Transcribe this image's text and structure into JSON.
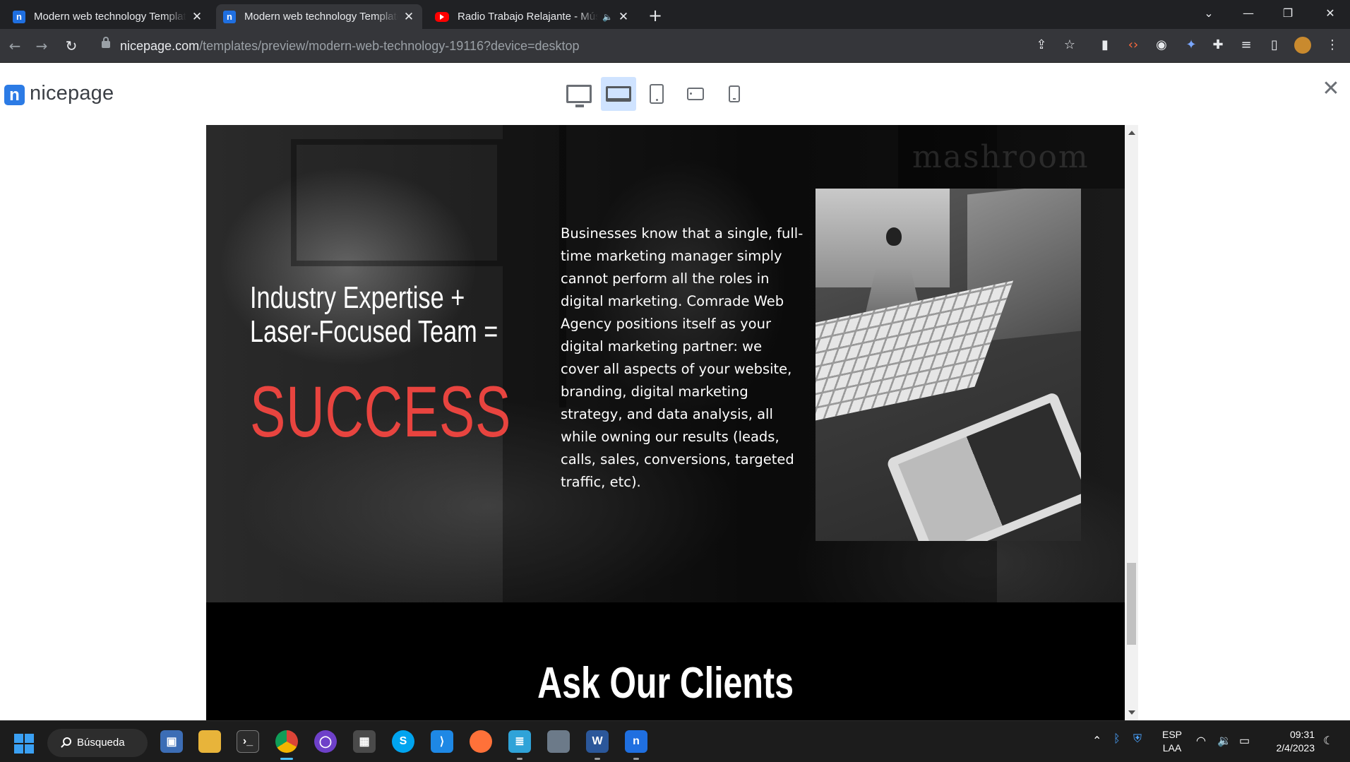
{
  "browser": {
    "tabs": [
      {
        "title": "Modern web technology Template",
        "favicon": "nicepage-favicon"
      },
      {
        "title": "Modern web technology Template",
        "favicon": "nicepage-favicon"
      },
      {
        "title": "Radio Trabajo Relajante - Música",
        "favicon": "youtube-favicon"
      }
    ],
    "new_tab": "+",
    "url_host": "nicepage.com",
    "url_path": "/templates/preview/modern-web-technology-19116?device=desktop"
  },
  "preview": {
    "logo_mark": "n",
    "logo_text": "nicepage",
    "close_glyph": "✕",
    "devices": [
      "desktop",
      "laptop",
      "tablet",
      "tablet-landscape",
      "phone"
    ],
    "selected_device": "laptop"
  },
  "site": {
    "headline_line1": "Industry Expertise +",
    "headline_line2": "Laser-Focused Team =",
    "success": "SUCCESS",
    "paragraph": "Businesses know that a single, full-time marketing manager simply cannot perform all the roles in digital marketing. Comrade Web Agency positions itself as your digital marketing partner: we cover all aspects of your website, branding, digital marketing strategy, and data analysis, all while owning our results (leads, calls, sales, conversions, targeted traffic, etc).",
    "background_wordmark": "mashroom",
    "clients_title": "Ask Our Clients",
    "accent_color": "#e8443f"
  },
  "taskbar": {
    "search_label": "Búsqueda",
    "lang_line1": "ESP",
    "lang_line2": "LAA",
    "time": "09:31",
    "date": "2/4/2023"
  }
}
